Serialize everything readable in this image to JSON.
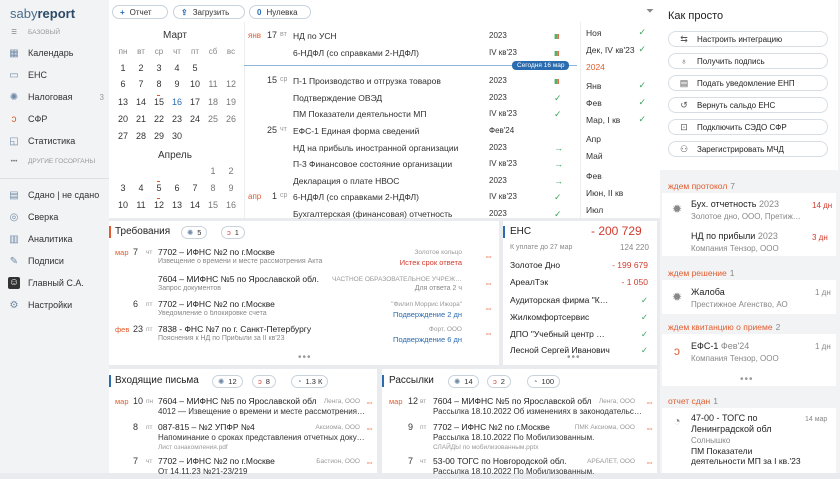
{
  "app": {
    "logo_a": "saby",
    "logo_b": "report"
  },
  "sidebar": {
    "section_base": "БАЗОВЫЙ",
    "items": [
      {
        "label": "Календарь",
        "icon": "calendar-icon",
        "count": ""
      },
      {
        "label": "ЕНС",
        "icon": "wallet-icon",
        "count": ""
      },
      {
        "label": "Налоговая",
        "icon": "tax-icon",
        "count": "3"
      },
      {
        "label": "СФР",
        "icon": "sfr-icon",
        "count": ""
      },
      {
        "label": "Статистика",
        "icon": "stats-icon",
        "count": ""
      }
    ],
    "section_other": "ДРУГИЕ ГОСОРГАНЫ",
    "items2": [
      {
        "label": "Сдано | не сдано",
        "icon": "done-icon"
      },
      {
        "label": "Сверка",
        "icon": "check-icon"
      },
      {
        "label": "Аналитика",
        "icon": "analytics-icon"
      },
      {
        "label": "Подписи",
        "icon": "signature-icon"
      },
      {
        "label": "Главный С.А.",
        "icon": "avatar"
      },
      {
        "label": "Настройки",
        "icon": "gear-icon"
      }
    ]
  },
  "toolbar": {
    "report": "Отчет",
    "upload": "Загрузить",
    "nulevka": "Нулевка"
  },
  "calendar": {
    "march": "Март",
    "april": "Апрель",
    "dow": [
      "пн",
      "вт",
      "ср",
      "чт",
      "пт",
      "сб",
      "вс"
    ],
    "march_weeks": [
      [
        "1",
        "2",
        "3",
        "4",
        "5"
      ],
      [
        "6",
        "7",
        "8",
        "9",
        "10",
        "11",
        "12"
      ],
      [
        "13",
        "14",
        "15",
        "16",
        "17",
        "18",
        "19"
      ],
      [
        "20",
        "21",
        "22",
        "23",
        "24",
        "25",
        "26"
      ],
      [
        "27",
        "28",
        "29",
        "30",
        "31"
      ]
    ],
    "april_weeks": [
      [
        "1",
        "2"
      ],
      [
        "3",
        "4",
        "5",
        "6",
        "7",
        "8",
        "9"
      ],
      [
        "10",
        "11",
        "12",
        "13",
        "14",
        "15",
        "16"
      ]
    ],
    "today": "16"
  },
  "events": [
    {
      "mo": "янв",
      "day": "17",
      "dw": "вт",
      "name": "НД по УСН",
      "period": "2023",
      "status": "bars"
    },
    {
      "mo": "",
      "day": "",
      "dw": "",
      "name": "6-НДФЛ (со справками 2-НДФЛ)",
      "period": "IV кв'23",
      "status": "bars"
    },
    {
      "mo": "",
      "day": "15",
      "dw": "ср",
      "name": "П-1 Производство и отгрузка товаров",
      "period": "2023",
      "status": "bars"
    },
    {
      "mo": "",
      "day": "",
      "dw": "",
      "name": "Подтверждение ОВЭД",
      "period": "2023",
      "status": "check"
    },
    {
      "mo": "",
      "day": "",
      "dw": "",
      "name": "ПМ Показатели деятельности МП",
      "period": "IV кв'23",
      "status": "check"
    },
    {
      "mo": "",
      "day": "25",
      "dw": "чт",
      "name": "ЕФС-1 Единая форма сведений",
      "period": "Фев'24",
      "status": ""
    },
    {
      "mo": "",
      "day": "",
      "dw": "",
      "name": "НД на прибыль иностранной организации",
      "period": "2023",
      "status": "arrow"
    },
    {
      "mo": "",
      "day": "",
      "dw": "",
      "name": "П-3 Финансовое состояние организации",
      "period": "IV кв'23",
      "status": "arrow"
    },
    {
      "mo": "",
      "day": "",
      "dw": "",
      "name": "Декларация о плате НВОС",
      "period": "2023",
      "status": "arrow"
    },
    {
      "mo": "апр",
      "day": "1",
      "dw": "ср",
      "name": "6-НДФЛ (со справками 2-НДФЛ)",
      "period": "IV кв'23",
      "status": "check"
    },
    {
      "mo": "",
      "day": "",
      "dw": "",
      "name": "Бухгалтерская (финансовая) отчетность",
      "period": "2023",
      "status": "check"
    }
  ],
  "today_badge": "Сегодня 16 мар",
  "periods": [
    {
      "name": "Ноя",
      "status": "check"
    },
    {
      "name": "Дек, IV кв'23",
      "status": "check"
    },
    {
      "name": "2024",
      "status": "year"
    },
    {
      "name": "Янв",
      "status": "check"
    },
    {
      "name": "Фев",
      "status": "check"
    },
    {
      "name": "Мар, I кв",
      "status": "check"
    },
    {
      "name": "Апр",
      "status": ""
    },
    {
      "name": "Май",
      "status": ""
    },
    {
      "name": "Июн",
      "status": ""
    },
    {
      "name": "Фев",
      "status": ""
    },
    {
      "name": "Июн, II кв",
      "status": ""
    },
    {
      "name": "Июл",
      "status": ""
    }
  ],
  "requirements": {
    "title": "Требования",
    "c1": "5",
    "c2": "1",
    "rows": [
      {
        "mo": "мар",
        "day": "7",
        "dw": "чт",
        "main": "7702 – ИФНС №2 по г.Москве",
        "sub": "Извещение о времени и месте рассмотрения Акта",
        "org": "Золотое кольцо",
        "status": "Истек срок ответа",
        "sc": "r"
      },
      {
        "mo": "",
        "day": "",
        "dw": "",
        "main": "7604 – МИФНС №5 по Ярославской обл.",
        "sub": "Запрос документов",
        "org": "ЧАСТНОЕ ОБРАЗОВАТЕЛЬНОЕ УЧРЕЖД...",
        "status": "Для ответа  2 ч",
        "sc": "g"
      },
      {
        "mo": "",
        "day": "6",
        "dw": "пт",
        "main": "7702 – ИФНС №2 по г.Москве",
        "sub": "Уведомление о блокировке счета",
        "org": "\"Филип Моррис Ижора\"",
        "status": "Подверждение  2 дн",
        "sc": "b"
      },
      {
        "mo": "фев",
        "day": "23",
        "dw": "пт",
        "main": "7838 - ФНС №7 по г. Санкт-Петербургу",
        "sub": "Пояснения к НД по Прибыли за II кв'23",
        "org": "Форт, ООО",
        "status": "Подверждение  6 дн",
        "sc": "b"
      }
    ]
  },
  "ens": {
    "title": "ЕНС",
    "total": "- 200 729",
    "due_label": "К уплате до 27 мар",
    "due_value": "124 220",
    "rows": [
      {
        "name": "Золотое Дно",
        "value": "- 199 679",
        "vc": "r"
      },
      {
        "name": "АреалТэк",
        "value": "- 1 050",
        "vc": "r"
      },
      {
        "name": "Аудиторская фирма \"Кв...",
        "value": "✓",
        "vc": "g"
      },
      {
        "name": "Жилкомфортсервис",
        "value": "✓",
        "vc": "g"
      },
      {
        "name": "ДПО \"Учебный центр Па...",
        "value": "✓",
        "vc": "g"
      },
      {
        "name": "Лесной Сергей Иванович",
        "value": "✓",
        "vc": "g"
      }
    ]
  },
  "incoming": {
    "title": "Входящие письма",
    "c1": "12",
    "c2": "8",
    "c3": "1.3 К",
    "rows": [
      {
        "mo": "мар",
        "day": "10",
        "dw": "пн",
        "main": "7604 – МИФНС №5 по Ярославской обл",
        "sub": "4012 — Извещение о времени и месте рассмотрения Акта",
        "org": "Ленга, ООО"
      },
      {
        "mo": "",
        "day": "8",
        "dw": "пт",
        "main": "087-815 – №2 УПФР №4",
        "sub": "Напоминание о сроках представления отчетных докуме...",
        "org": "Аксиома, ООО",
        "sub2": "Лист ознакомления.pdf"
      },
      {
        "mo": "",
        "day": "7",
        "dw": "чт",
        "main": "7702 – ИФНС №2 по г.Москве",
        "sub": "От 14.11.23 №21-23/219",
        "org": "Бастион, ООО"
      }
    ]
  },
  "mailing": {
    "title": "Рассылки",
    "c1": "14",
    "c2": "2",
    "c3": "100",
    "rows": [
      {
        "mo": "мар",
        "day": "12",
        "dw": "вт",
        "main": "7604 – МИФНС №5 по Ярославской обл",
        "sub": "Рассылка 18.10.2022 Об изменениях в законодательстве...",
        "org": "Ленга, ООО"
      },
      {
        "mo": "",
        "day": "9",
        "dw": "пт",
        "main": "7702 – ИФНС №2 по г.Москве",
        "sub": "Рассылка 18.10.2022 По Мобилизованным.",
        "org": "ПМК Аксиома, ООО",
        "sub2": "СЛАЙДЫ по мобилизованным.pptx"
      },
      {
        "mo": "",
        "day": "7",
        "dw": "чт",
        "main": "53-00 ТОГС по Новгородской обл.",
        "sub": "Рассылка 18.10.2022 По Мобилизованным.",
        "org": "АРБАЛЕТ, ООО"
      }
    ]
  },
  "howto": {
    "title": "Как просто",
    "items": [
      {
        "label": "Настроить интеграцию",
        "icon": "integration-icon"
      },
      {
        "label": "Получить подпись",
        "icon": "signature-icon"
      },
      {
        "label": "Подать уведомление ЕНП",
        "icon": "notice-icon"
      },
      {
        "label": "Вернуть сальдо ЕНС",
        "icon": "return-icon"
      },
      {
        "label": "Подключить СЭДО СФР",
        "icon": "connect-icon"
      },
      {
        "label": "Зарегистрировать МЧД",
        "icon": "register-icon"
      }
    ]
  },
  "groups": {
    "protocol": {
      "label": "ждем протокол",
      "count": "7",
      "items": [
        {
          "title": "Бух. отчетность",
          "period": "2023",
          "sub": "Золотое дно, ООО, Претижно...",
          "days": "14 дн",
          "dc": "r"
        },
        {
          "title": "НД по прибыли",
          "period": "2023",
          "sub": "Компания Тензор, ООО",
          "days": "3 дн",
          "dc": "r"
        }
      ]
    },
    "decision": {
      "label": "ждем решение",
      "count": "1",
      "items": [
        {
          "title": "Жалоба",
          "period": "",
          "sub": "Престижное Агенство, АО",
          "days": "1 дн",
          "dc": "g"
        }
      ]
    },
    "receipt": {
      "label": "ждем квитанцию о приеме",
      "count": "2",
      "items": [
        {
          "title": "ЕФС-1",
          "period": "Фев'24",
          "sub": "Компания Тензор, ООО",
          "days": "1 дн",
          "dc": "g"
        }
      ]
    },
    "sent": {
      "label": "отчет сдан",
      "count": "1",
      "item": {
        "title1": "47-00 - ТОГС по",
        "title2": "Ленинградской обл",
        "sub1": "Солнышко",
        "sub2": "ПМ Показатели",
        "sub3": "деятельности",
        "sub4": "МП за I кв.'23",
        "date": "14 мар"
      }
    }
  }
}
